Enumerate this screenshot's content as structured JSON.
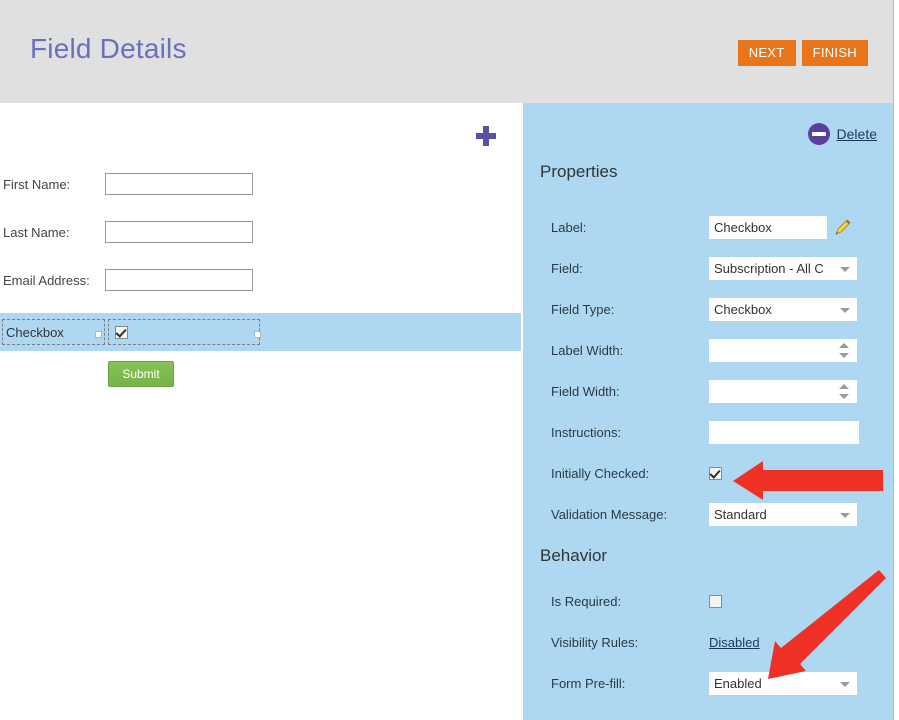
{
  "header": {
    "title": "Field Details",
    "next_label": "NEXT",
    "finish_label": "FINISH",
    "button_color": "#e8751a",
    "title_color": "#6b6fc0",
    "background": "#e0e0e0"
  },
  "form_preview": {
    "add_field_icon": "plus-icon",
    "rows": [
      {
        "label": "First Name:",
        "value": "",
        "type": "text"
      },
      {
        "label": "Last Name:",
        "value": "",
        "type": "text"
      },
      {
        "label": "Email Address:",
        "value": "",
        "type": "text"
      }
    ],
    "selected_row": {
      "label": "Checkbox",
      "type": "checkbox",
      "checked": true,
      "highlight_color": "#aed8f2"
    },
    "submit_label": "Submit",
    "submit_color": "#7ab94c"
  },
  "properties_panel": {
    "background": "#aed8f2",
    "delete_label": "Delete",
    "delete_icon": "minus-circle-icon",
    "sections": {
      "properties_title": "Properties",
      "behavior_title": "Behavior"
    },
    "fields": {
      "label": {
        "label": "Label:",
        "value": "Checkbox",
        "edit_icon": "pencil-icon"
      },
      "field": {
        "label": "Field:",
        "value": "Subscription - All C"
      },
      "field_type": {
        "label": "Field Type:",
        "value": "Checkbox"
      },
      "label_width": {
        "label": "Label Width:",
        "value": ""
      },
      "field_width": {
        "label": "Field Width:",
        "value": ""
      },
      "instructions": {
        "label": "Instructions:",
        "value": ""
      },
      "initially_checked": {
        "label": "Initially Checked:",
        "checked": true
      },
      "validation_message": {
        "label": "Validation Message:",
        "value": "Standard"
      },
      "is_required": {
        "label": "Is Required:",
        "checked": false
      },
      "visibility_rules": {
        "label": "Visibility Rules:",
        "value": "Disabled"
      },
      "form_prefill": {
        "label": "Form Pre-fill:",
        "value": "Enabled"
      }
    }
  },
  "annotations": {
    "arrow_color": "#ee3124",
    "arrow_1_target": "initially-checked-checkbox",
    "arrow_2_target": "form-prefill-select"
  }
}
